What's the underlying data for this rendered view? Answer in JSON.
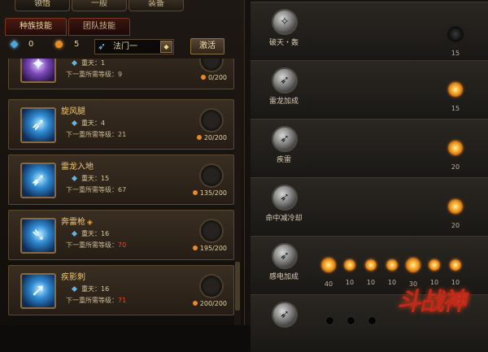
{
  "tabs": {
    "top": [
      "领悟",
      "一般",
      "装备"
    ],
    "sub": [
      "种族技能",
      "团队技能"
    ]
  },
  "resources": {
    "blue_points": "0",
    "orange_points": "5"
  },
  "school": {
    "selected": "法门一",
    "activate_label": "激活"
  },
  "skills": [
    {
      "name": "",
      "level_text": "重天：1",
      "next_text_prefix": "下一重所需等级：",
      "next_level": "9",
      "next_red": false,
      "cost": "0/200"
    },
    {
      "name": "旋风腿",
      "level_text": "重天：4",
      "next_text_prefix": "下一重所需等级：",
      "next_level": "21",
      "next_red": false,
      "cost": "20/200"
    },
    {
      "name": "雷龙入地",
      "level_text": "重天：15",
      "next_text_prefix": "下一重所需等级：",
      "next_level": "67",
      "next_red": false,
      "cost": "135/200"
    },
    {
      "name": "奔雷枪",
      "level_text": "重天：16",
      "next_text_prefix": "下一重所需等级：",
      "next_level": "70",
      "next_red": true,
      "cost": "195/200"
    },
    {
      "name": "疾影刺",
      "level_text": "重天：16",
      "next_text_prefix": "下一重所需等级：",
      "next_level": "71",
      "next_red": true,
      "cost": "200/200"
    }
  ],
  "talents": [
    {
      "name": "破天・轰",
      "gem_values": [
        "15"
      ]
    },
    {
      "name": "雷龙加成",
      "gem_values": [
        "15"
      ]
    },
    {
      "name": "疾雷",
      "gem_values": [
        "20"
      ]
    },
    {
      "name": "命中减冷却",
      "gem_values": [
        "20"
      ]
    },
    {
      "name": "感电加成",
      "gem_values": [
        "40",
        "10",
        "10",
        "10",
        "30",
        "10",
        "10"
      ]
    },
    {
      "name": "",
      "gem_values": []
    }
  ],
  "colors": {
    "accent_gold": "#f0c870",
    "red_text": "#e64b2c",
    "blue_gem": "#4aa8e0",
    "orange_gem": "#e98b24"
  },
  "icons": [
    "blue-gem-icon",
    "orange-gem-icon",
    "wing-icon",
    "dropdown-arrow-icon",
    "skill-slot-icon",
    "sun-gem-icon"
  ]
}
